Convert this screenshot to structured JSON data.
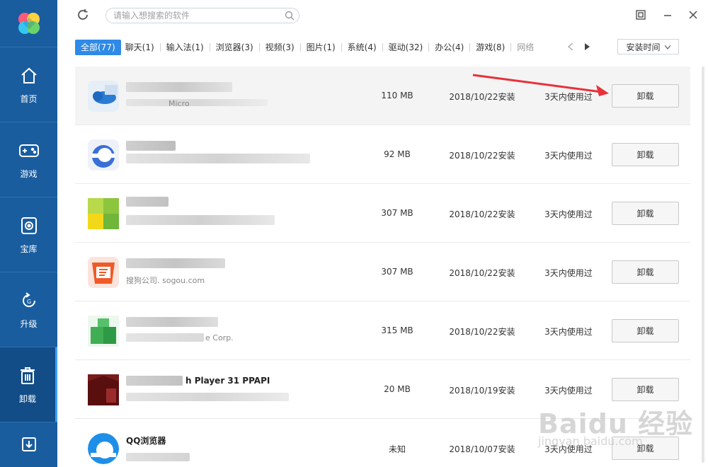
{
  "search": {
    "placeholder": "请输入想搜索的软件"
  },
  "sidebar": {
    "items": [
      {
        "label": "首页",
        "icon": "home-icon"
      },
      {
        "label": "游戏",
        "icon": "gamepad-icon"
      },
      {
        "label": "宝库",
        "icon": "disc-icon"
      },
      {
        "label": "升级",
        "icon": "upgrade-icon"
      },
      {
        "label": "卸载",
        "icon": "trash-icon",
        "active": true
      }
    ],
    "bottom_icon": "download-icon"
  },
  "tabs": [
    {
      "label": "全部(77)",
      "active": true
    },
    {
      "label": "聊天(1)"
    },
    {
      "label": "输入法(1)"
    },
    {
      "label": "浏览器(3)"
    },
    {
      "label": "视频(3)"
    },
    {
      "label": "图片(1)"
    },
    {
      "label": "系统(4)"
    },
    {
      "label": "驱动(32)"
    },
    {
      "label": "办公(4)"
    },
    {
      "label": "游戏(8)"
    },
    {
      "label": "网络"
    }
  ],
  "sort": {
    "selected": "安装时间"
  },
  "rows": [
    {
      "name_fragment": "",
      "sub_fragment": "Micro",
      "size": "110 MB",
      "date": "2018/10/22安装",
      "used": "3天内使用过",
      "action": "卸载"
    },
    {
      "name_fragment": "",
      "sub_fragment": "",
      "size": "92 MB",
      "date": "2018/10/22安装",
      "used": "3天内使用过",
      "action": "卸载"
    },
    {
      "name_fragment": "",
      "sub_fragment": "",
      "size": "307 MB",
      "date": "2018/10/22安装",
      "used": "3天内使用过",
      "action": "卸载"
    },
    {
      "name_fragment": "",
      "sub_fragment": "搜狗公司. sogou.com",
      "size": "307 MB",
      "date": "2018/10/22安装",
      "used": "3天内使用过",
      "action": "卸载"
    },
    {
      "name_fragment": "",
      "sub_fragment": "e Corp.",
      "size": "315 MB",
      "date": "2018/10/22安装",
      "used": "3天内使用过",
      "action": "卸载"
    },
    {
      "name_fragment": "h Player 31 PPAPI",
      "sub_fragment": "",
      "size": "20 MB",
      "date": "2018/10/19安装",
      "used": "3天内使用过",
      "action": "卸载"
    },
    {
      "name_fragment": "QQ浏览器",
      "sub_fragment": "",
      "size": "未知",
      "date": "2018/10/07安装",
      "used": "3天内使用过",
      "action": "卸载"
    }
  ],
  "watermark": {
    "text": "Baidu 经验",
    "sub": "jingyan.baidu.com"
  }
}
